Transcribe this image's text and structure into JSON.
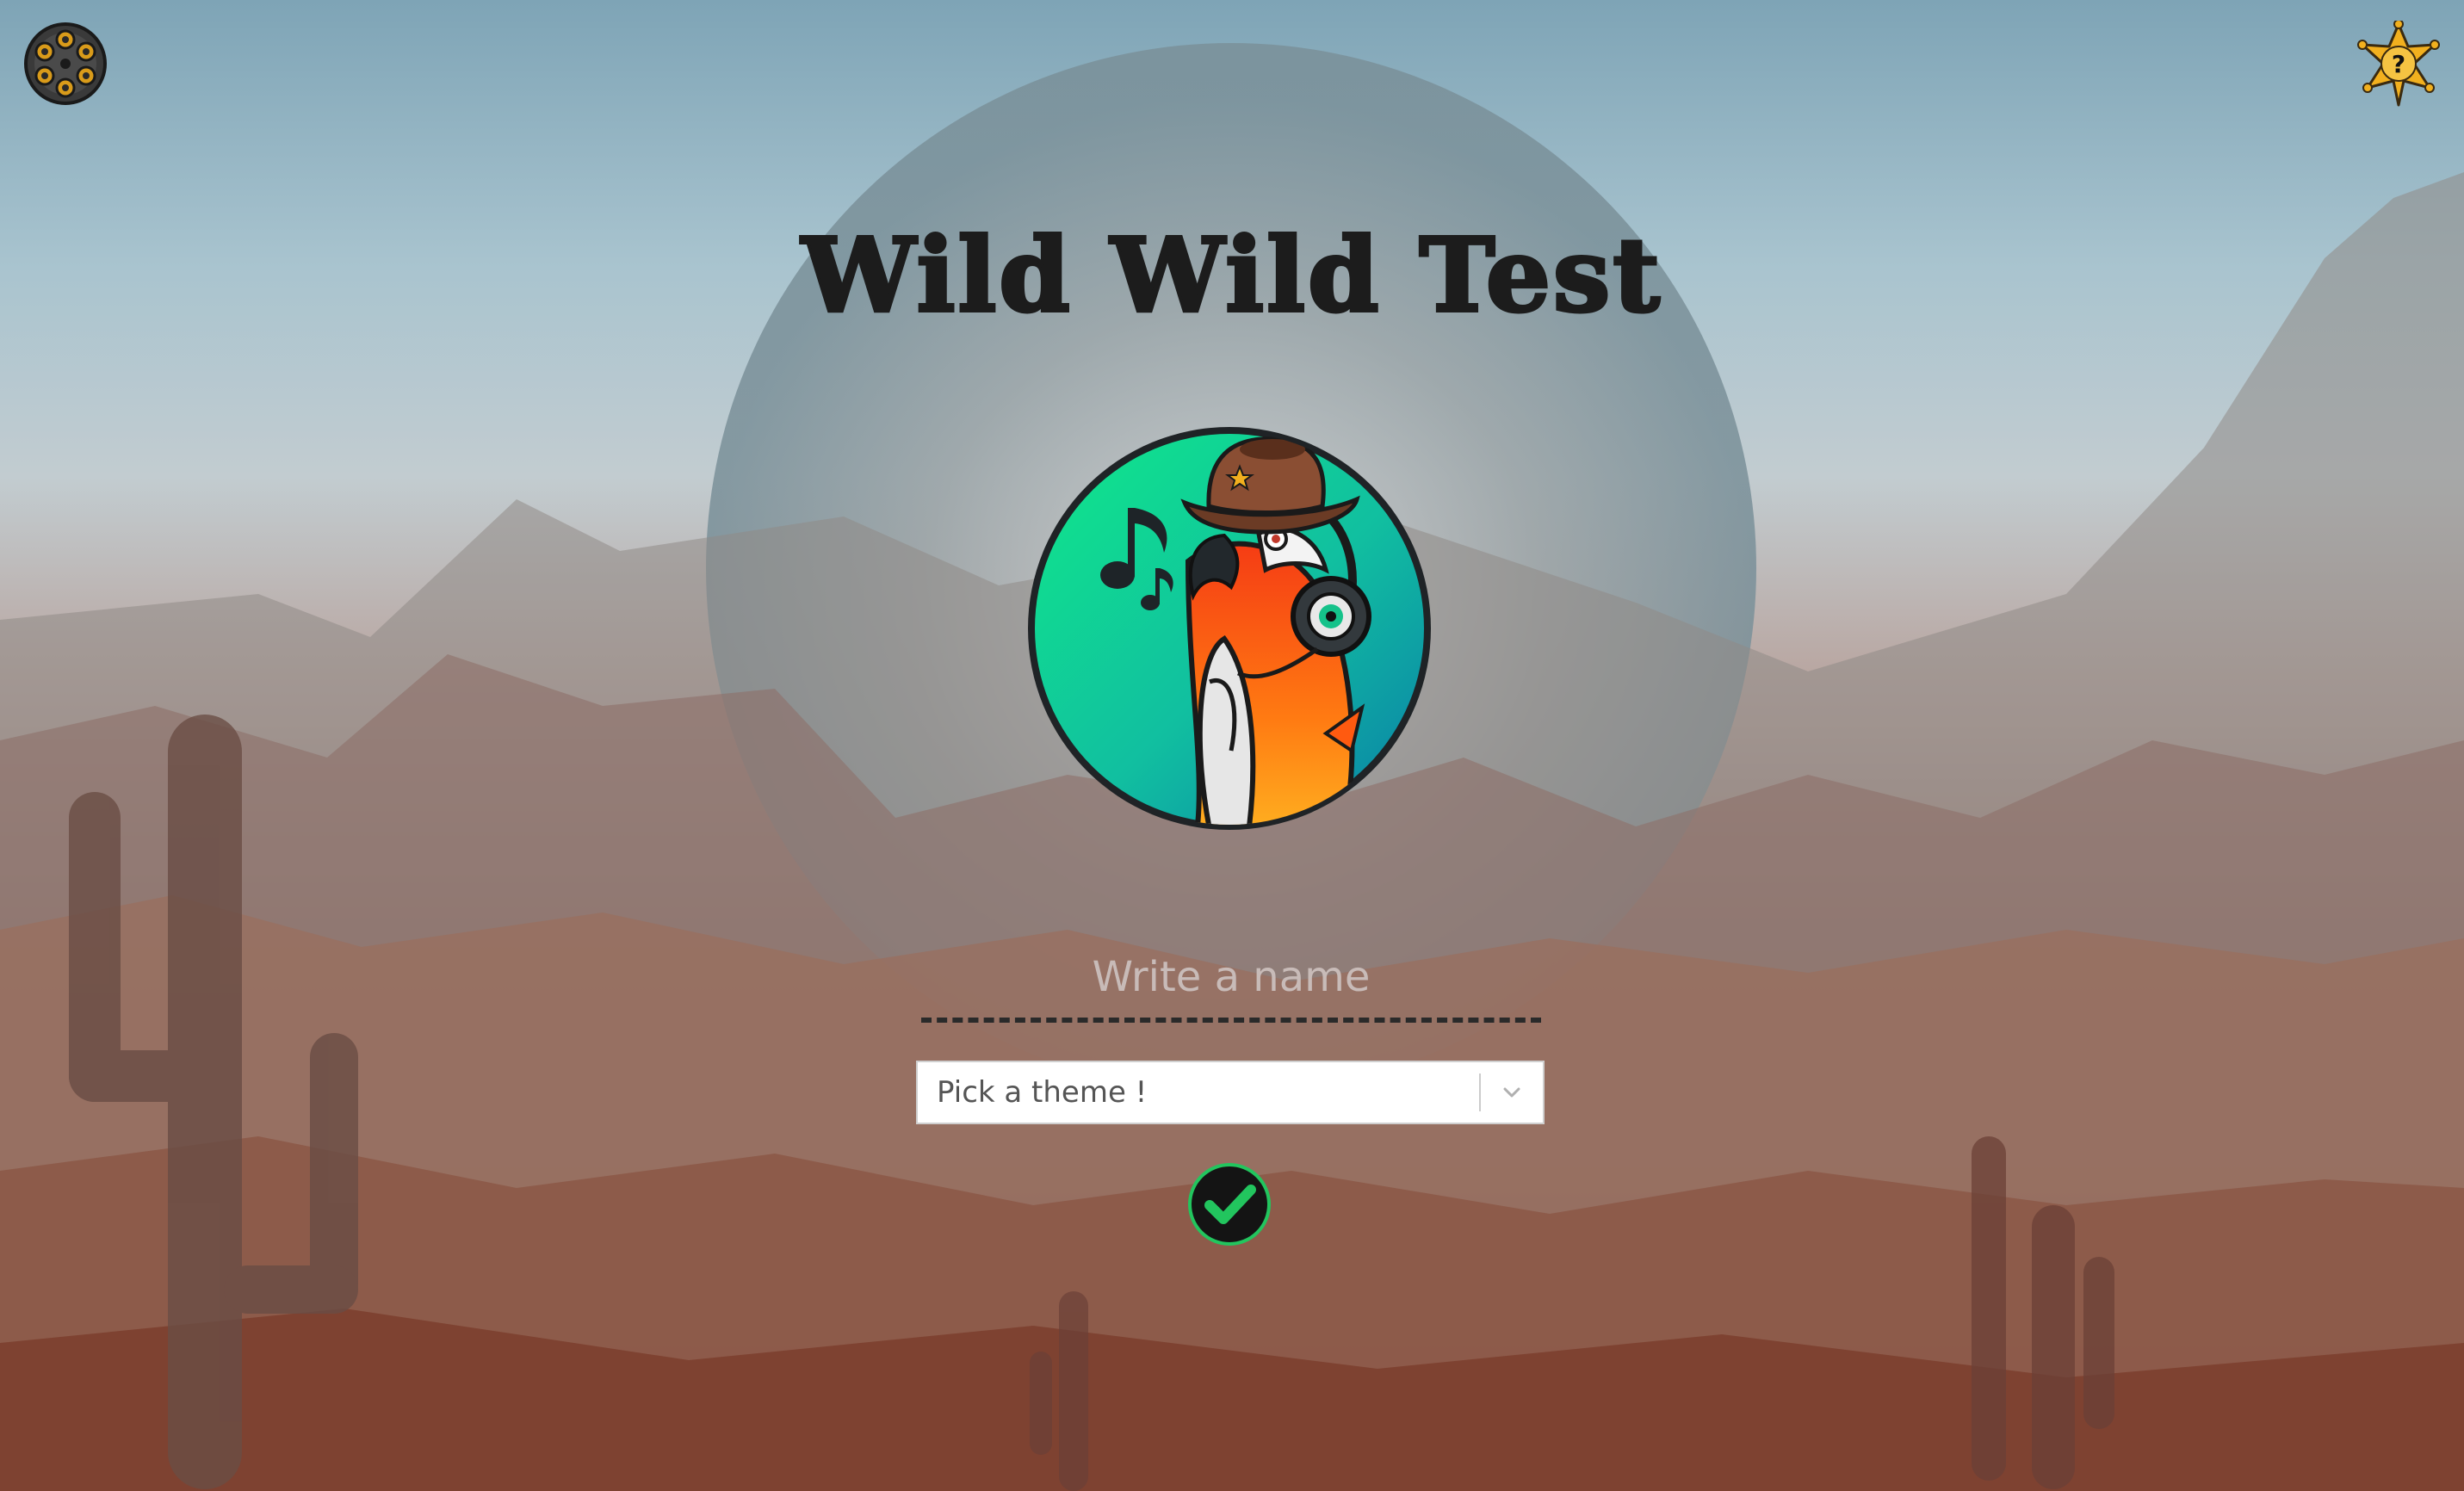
{
  "app": {
    "title": "Wild Wild Test"
  },
  "header": {
    "settings_icon": "revolver-cylinder-icon",
    "help_icon": "sheriff-star-help-icon"
  },
  "logo": {
    "icon": "cowboy-parrot-headphones-logo"
  },
  "form": {
    "name_placeholder": "Write a name",
    "name_value": "",
    "theme_placeholder": "Pick a theme !",
    "confirm_icon": "checkmark-icon"
  },
  "colors": {
    "accent_green": "#22c55e",
    "star_gold": "#f2b01e",
    "title_color": "#1c1c1c"
  }
}
